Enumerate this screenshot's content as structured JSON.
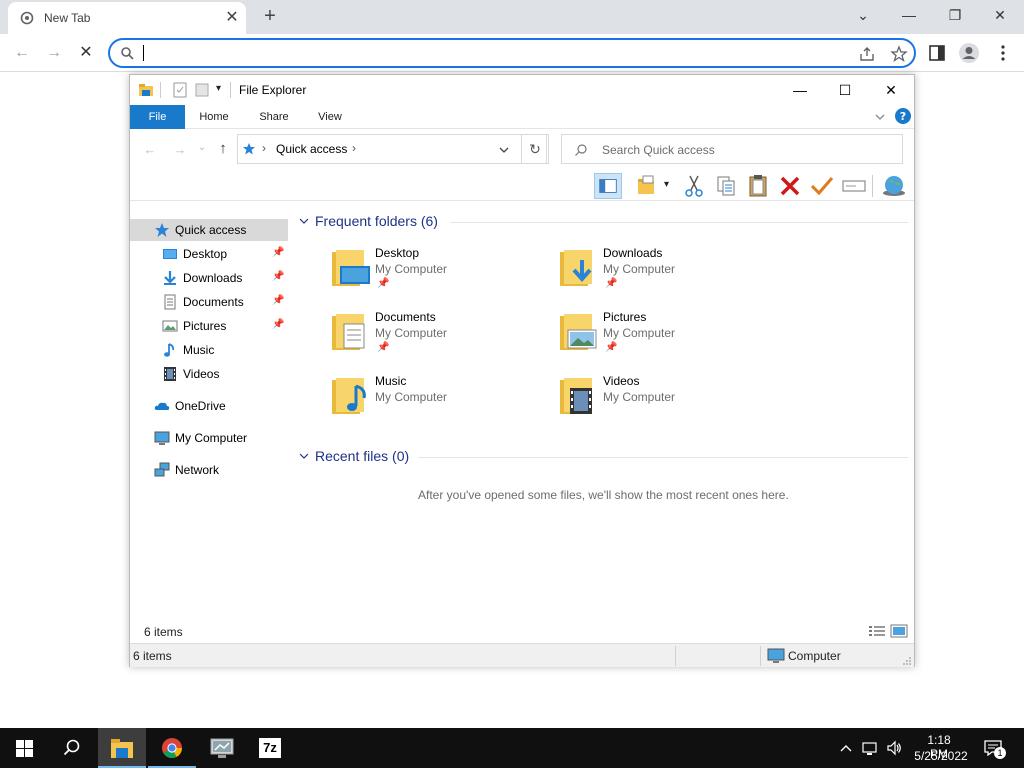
{
  "browser": {
    "tab_title": "New Tab",
    "tab_close_glyph": "✕",
    "new_tab_glyph": "+",
    "window_controls": {
      "tabsearch": "⌄",
      "minimize": "—",
      "restore": "❐",
      "close": "✕"
    },
    "nav": {
      "back": "←",
      "forward": "→",
      "stop": "✕"
    },
    "omnibox": {
      "value": "",
      "placeholder": ""
    },
    "accent": "#1a73e8"
  },
  "explorer": {
    "title": "File Explorer",
    "window_controls": {
      "minimize": "—",
      "maximize": "☐",
      "close": "✕"
    },
    "ribbon_tabs": [
      "File",
      "Home",
      "Share",
      "View"
    ],
    "nav": {
      "back": "←",
      "forward": "→",
      "recent": "⌄",
      "up": "↑",
      "refresh": "↻"
    },
    "address": {
      "segment": "Quick access",
      "sep": "›"
    },
    "search_placeholder": "Search Quick access",
    "nav_pane": [
      {
        "label": "Quick access",
        "icon": "star-icon",
        "selected": true
      },
      {
        "label": "Desktop",
        "icon": "desktop-icon",
        "pinned": true
      },
      {
        "label": "Downloads",
        "icon": "downloads-icon",
        "pinned": true
      },
      {
        "label": "Documents",
        "icon": "documents-icon",
        "pinned": true
      },
      {
        "label": "Pictures",
        "icon": "pictures-icon",
        "pinned": true
      },
      {
        "label": "Music",
        "icon": "music-icon"
      },
      {
        "label": "Videos",
        "icon": "videos-icon"
      },
      {
        "label": "OneDrive",
        "icon": "onedrive-icon"
      },
      {
        "label": "My Computer",
        "icon": "computer-icon"
      },
      {
        "label": "Network",
        "icon": "network-icon"
      }
    ],
    "frequent_header": "Frequent folders (6)",
    "folders": [
      {
        "name": "Desktop",
        "location": "My Computer",
        "pinned": true
      },
      {
        "name": "Downloads",
        "location": "My Computer",
        "pinned": true
      },
      {
        "name": "Documents",
        "location": "My Computer",
        "pinned": true
      },
      {
        "name": "Pictures",
        "location": "My Computer",
        "pinned": true
      },
      {
        "name": "Music",
        "location": "My Computer",
        "pinned": false
      },
      {
        "name": "Videos",
        "location": "My Computer",
        "pinned": false
      }
    ],
    "recent_header": "Recent files (0)",
    "recent_message": "After you've opened some files, we'll show the most recent ones here.",
    "item_count": "6 items",
    "status": {
      "left": "6 items",
      "right": "Computer"
    },
    "ribbon_accent": "#1979ca"
  },
  "taskbar": {
    "time": "1:18 PM",
    "date": "5/25/2022",
    "notification_count": "1",
    "apps": [
      "file-explorer",
      "chrome",
      "control-panel",
      "7zip"
    ],
    "app_7z_label": "7z"
  }
}
